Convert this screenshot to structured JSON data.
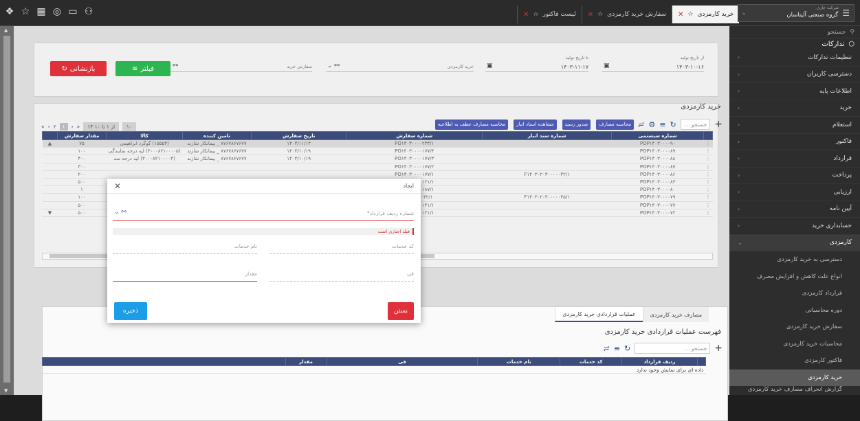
{
  "window": {
    "tabs": [
      {
        "label": "خرید کارمزدی",
        "active": true
      },
      {
        "label": "سفارش خرید کارمزدی",
        "active": false
      },
      {
        "label": "لیست فاکتور",
        "active": false
      }
    ],
    "org_caption": "شرکت جاری",
    "org_name": "گروه صنعتی آلیتاسان"
  },
  "sidebar": {
    "search_placeholder": "جستجو",
    "section_title": "تدارکات",
    "items": [
      {
        "label": "تنظیمات تدارکات"
      },
      {
        "label": "دسترسی کاربران"
      },
      {
        "label": "اطلاعات پایه"
      },
      {
        "label": "خرید"
      },
      {
        "label": "استعلام"
      },
      {
        "label": "فاکتور"
      },
      {
        "label": "قرارداد"
      },
      {
        "label": "پرداخت"
      },
      {
        "label": "ارزیابی"
      },
      {
        "label": "آیین نامه"
      },
      {
        "label": "حسابداری خرید"
      },
      {
        "label": "کارمزدی"
      }
    ],
    "sub_items": [
      {
        "label": "دسترسی به خرید کارمزدی"
      },
      {
        "label": "انواع علت کاهش و افزایش مصرف"
      },
      {
        "label": "قرارداد کارمزدی"
      },
      {
        "label": "دوره محاسباتی"
      },
      {
        "label": "سفارش خرید کارمزدی"
      },
      {
        "label": "محاسبات خرید کارمزدی"
      },
      {
        "label": "فاکتور کارمزدی"
      },
      {
        "label": "خرید کارمزدی"
      },
      {
        "label": "گزارش انحراف مصارف خرید کارمزدی"
      }
    ]
  },
  "filter": {
    "from_date_label": "از تاریخ تولید",
    "from_date_value": "۱۴۰۳-۱۰-۱۶",
    "to_date_label": "تا تاریخ تولید",
    "to_date_value": "۱۴۰۳-۱۱-۱۷",
    "purchase_label": "خرید کارمزدی",
    "order_label": "سفارش خرید",
    "filter_btn": "فیلتر",
    "reset_btn": "بازنشانی"
  },
  "grid": {
    "title": "خرید کارمزدی",
    "search_placeholder": "جستجو ...",
    "actions": [
      "محاسبه مصارف",
      "صدور رسید",
      "مشاهده اسناد انبار",
      "محاسبه مصارف عطف به اطلاعیه"
    ],
    "pager_info": "۱۴ از ۱ تا ۱۰",
    "page_size": "۱۰",
    "pages": [
      "۱",
      "۲"
    ],
    "columns": [
      "شماره سیستمی",
      "شماره سند انبار",
      "شماره سفارش",
      "تاریخ سفارش",
      "تامین کننده",
      "کالا",
      "مقدار سفارش"
    ],
    "rows": [
      [
        "POP۱۴۰۳۰۰۰۰۹۰",
        "",
        "PO۱۴۰۳۰۰۰۰۲۳۳/۱",
        "۱۴۰۳/۱۱/۱۴",
        "۸۷۶۷۸۶۷۶۷۷ _ پیمانکار شازند",
        "(۱۵۵۵۳) گوگرد ابراهیمی",
        "۷۵"
      ],
      [
        "POP۱۴۰۳۰۰۰۰۸۹",
        "",
        "PO۱۴۰۳۰۰۰۰۱۷۷/۴",
        "۱۴۰۳/۱۰/۱۹",
        "۸۷۶۷۸۶۷۶۷۷ _ پیمانکار شازند",
        "(۳۰۰۰۸۲۱۰۰۰۰۵) لپه درجه نمایندگی",
        "۱۰۰"
      ],
      [
        "POP۱۴۰۳۰۰۰۰۸۸",
        "",
        "PO۱۴۰۳۰۰۰۰۱۷۷/۳",
        "۱۴۰۳/۱۰/۱۹",
        "۸۷۶۷۸۶۷۶۷۷ _ پیمانکار شازند",
        "(۳۰۰۰۸۲۱۰۰۰۰۴) لپه درجه سه",
        "۴۰۰"
      ],
      [
        "POP۱۴۰۳۰۰۰۰۸۷",
        "",
        "PO۱۴۰۳۰۰۰۰۱۷۷/۲",
        "",
        "",
        "",
        "۳۰۰"
      ],
      [
        "POP۱۴۰۳۰۰۰۰۸۶",
        "F۱۴۰۳۰۲۰۳۰۰۰۰۰۴۲/۱",
        "PO۱۴۰۳۰۰۰۰۱۷۷/۱",
        "",
        "",
        "",
        "۲۰۰"
      ],
      [
        "POP۱۴۰۳۰۰۰۰۸۳",
        "",
        "PO۱۴۰۳۰۰۰۰۱۲۱/۱",
        "",
        "",
        "",
        "۵۰۰"
      ],
      [
        "POP۱۴۰۳۰۰۰۰۸۰",
        "",
        "PO۱۴۰۳۰۰۰۰۱۸۷/۱",
        "",
        "",
        "",
        "۱"
      ],
      [
        "POP۱۴۰۳۰۰۰۰۷۹",
        "F۱۴۰۳۰۲۰۳۰۰۰۰۰۴۵/۱",
        "PO۱۴۰۳۰۰۰۰۴۲/۱",
        "",
        "",
        "",
        "۱۰۰"
      ],
      [
        "POP۱۴۰۳۰۰۰۰۷۷",
        "",
        "PO۱۴۰۳۰۰۰۰۱۴۱/۱",
        "",
        "",
        "",
        "۵۰۰"
      ],
      [
        "POP۱۴۰۳۰۰۰۰۷۲",
        "",
        "PO۱۴۰۳۰۰۰۰۱۲۱/۱",
        "",
        "",
        "",
        "۵۰۰"
      ]
    ]
  },
  "bottom": {
    "tabs": [
      "مصارف خرید کارمزدی",
      "عملیات قراردادی خرید کارمزدی"
    ],
    "title": "فهرست عملیات قراردادی خرید کارمزدی",
    "search_placeholder": "جستجو ...",
    "columns": [
      "ردیف قرارداد",
      "کد خدمات",
      "نام خدمات",
      "فی",
      "مقدار"
    ],
    "empty": "داده ای برای نمایش وجود ندارد"
  },
  "modal": {
    "title": "ایجاد",
    "contract_row_label": "شماره ردیف قرارداد*",
    "required_msg": "فیلد اجباری است",
    "service_code_label": "کد خدمات",
    "service_name_label": "نام خدمات",
    "price_label": "فی",
    "quantity_label": "مقدار",
    "close_btn": "بستن",
    "save_btn": "ذخیره"
  },
  "colors": {
    "accent": "#3b4b7a",
    "reset": "#e0313a",
    "filter": "#2db552",
    "save": "#1a9ee8",
    "close": "#e0313a"
  }
}
